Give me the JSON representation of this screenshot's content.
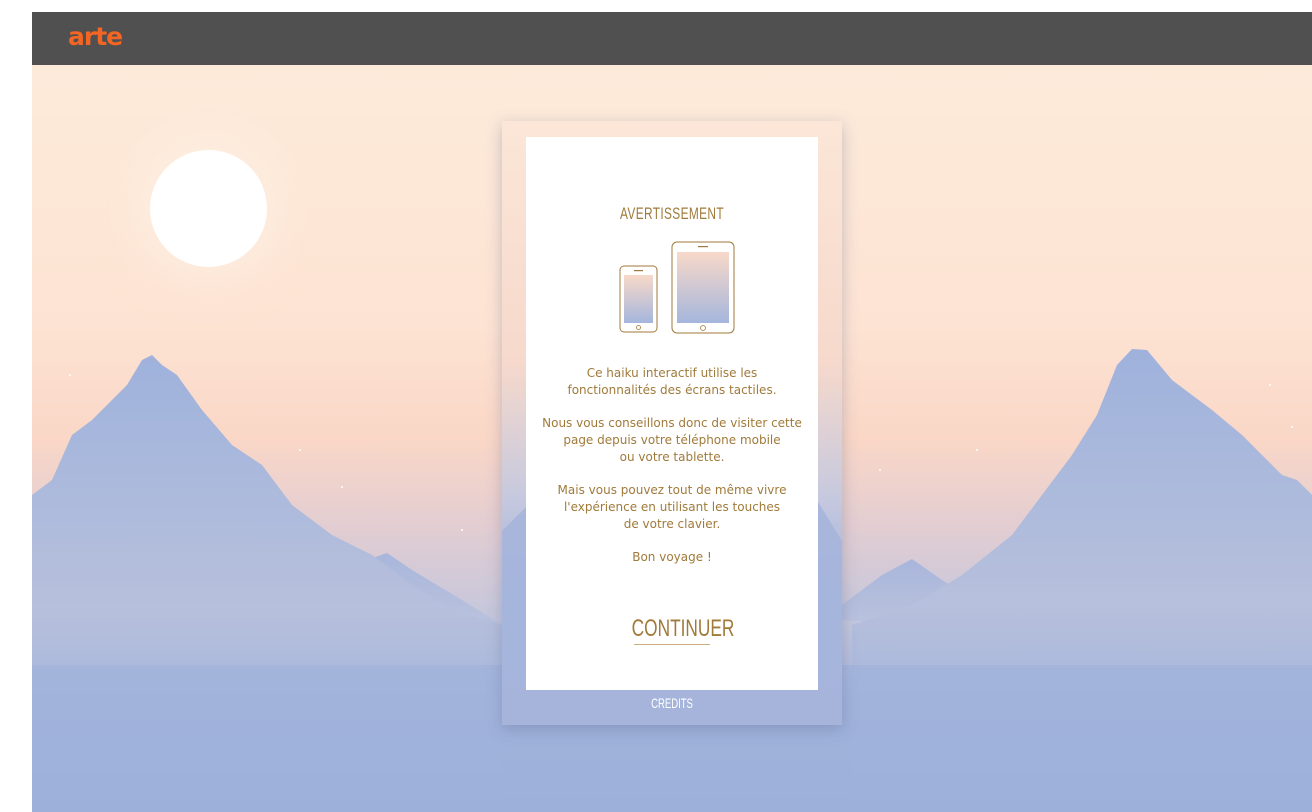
{
  "header": {
    "logo_text": "arte",
    "logo_color": "#f26522",
    "background_color": "#505050"
  },
  "background": {
    "sky_top_color": "#fdebda",
    "sky_horizon_color": "#fad7c7",
    "mountain_color": "#9cb0da",
    "sun_color": "#ffffff"
  },
  "dialog": {
    "title": "AVERTISSEMENT",
    "icons": [
      "smartphone-icon",
      "tablet-icon"
    ],
    "paragraphs": [
      "Ce haiku interactif utilise les\nfonctionnalités des écrans tactiles.",
      "Nous vous conseillons donc de visiter cette\npage depuis votre téléphone mobile\nou votre tablette.",
      "Mais vous pouvez tout de même vivre\nl'expérience en utilisant  les touches\nde votre clavier.",
      "Bon voyage !"
    ],
    "continue_label": "CONTINUER",
    "credits_label": "CREDITS",
    "text_color": "#a07a3a"
  }
}
